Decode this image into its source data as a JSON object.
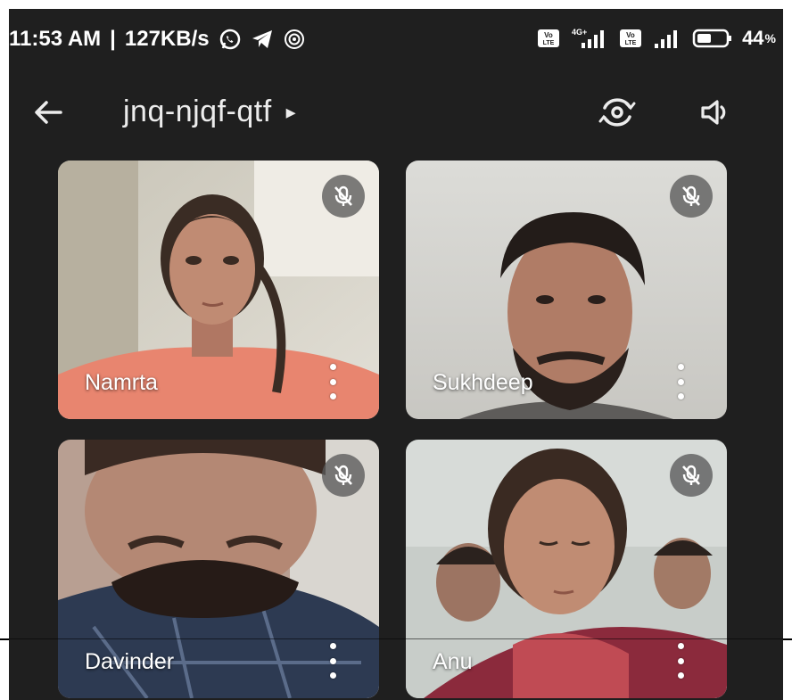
{
  "status_bar": {
    "time": "11:53 AM",
    "separator": "|",
    "network_speed": "127KB/s",
    "icons": [
      "whatsapp-icon",
      "telegram-icon",
      "app-notification-icon",
      "volte-icon",
      "signal-4g-icon",
      "volte-icon",
      "signal-icon",
      "battery-icon"
    ],
    "network_type": "4G+",
    "volte_label": "Vo LTE",
    "battery_percent": "44"
  },
  "header": {
    "meeting_code": "jnq-njqf-qtf",
    "caret": "▸",
    "actions": [
      "back-arrow-icon",
      "switch-camera-icon",
      "speaker-icon"
    ]
  },
  "participants": [
    {
      "name": "Namrta",
      "muted": true
    },
    {
      "name": "Sukhdeep",
      "muted": true
    },
    {
      "name": "Davinder",
      "muted": true
    },
    {
      "name": "Anu",
      "muted": true
    }
  ],
  "colors": {
    "background": "#1f1f1f",
    "text": "#ffffff",
    "badge": "#5a5a5a"
  }
}
